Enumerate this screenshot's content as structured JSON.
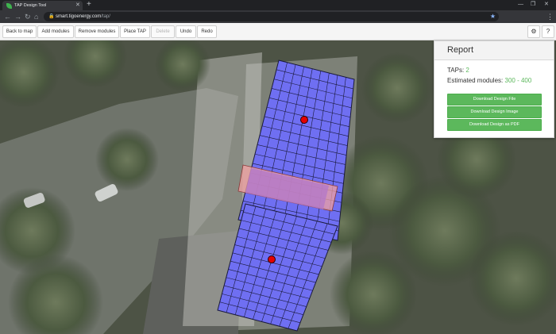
{
  "browser": {
    "tab_title": "TAP Design Tool",
    "tab_close": "✕",
    "new_tab": "+",
    "url_host": "smart.tigoenergy.com",
    "url_path": "/tap/",
    "minimize": "—",
    "maximize": "❐",
    "close": "✕",
    "menu": "⋮"
  },
  "toolbar": {
    "buttons": [
      {
        "label": "Back to map",
        "enabled": true
      },
      {
        "label": "Add modules",
        "enabled": true
      },
      {
        "label": "Remove modules",
        "enabled": true
      },
      {
        "label": "Place TAP",
        "enabled": true
      },
      {
        "label": "Delete",
        "enabled": false
      },
      {
        "label": "Undo",
        "enabled": true
      },
      {
        "label": "Redo",
        "enabled": true
      }
    ],
    "settings_icon": "gear-icon",
    "help_icon": "question-circle-icon"
  },
  "report": {
    "title": "Report",
    "taps_label": "TAPs:",
    "taps_value": "2",
    "modules_label": "Estimated modules:",
    "modules_value": "300 - 400",
    "buttons": [
      "Download Design File",
      "Download Design Image",
      "Download Design as PDF"
    ]
  },
  "colors": {
    "module_fill": "#6f6ff2",
    "tap_marker": "#e50000",
    "selection": "#f2a0a0",
    "report_accent": "#5cb85c"
  }
}
